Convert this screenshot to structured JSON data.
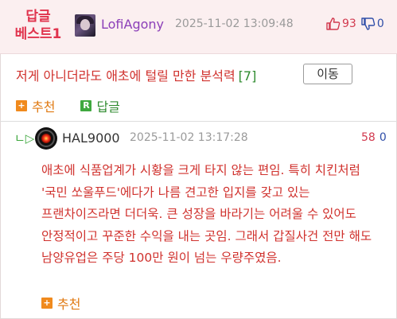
{
  "best_reply": {
    "badge_line1": "답글",
    "badge_line2": "베스트1",
    "nickname": "LofiAgony",
    "datetime": "2025-11-02 13:09:48",
    "upvotes": "93",
    "downvotes": "0"
  },
  "parent_quote": {
    "text": "저게 아니더라도 애초에 털릴 만한 분석력",
    "reply_count": "[7]",
    "move_button": "이동"
  },
  "actions": {
    "recommend_label": "추천",
    "reply_label": "답글"
  },
  "reply_comment": {
    "arrow": "ㄴ▷",
    "nickname": "HAL9000",
    "datetime": "2025-11-02 13:17:28",
    "upvotes": "58",
    "downvotes": "0",
    "body": "애초에 식품업계가 시황을 크게 타지 않는 편임. 특히 치킨처럼 '국민 쏘울푸드'에다가 나름 견고한 입지를 갖고 있는 프랜차이즈라면 더더욱. 큰 성장을 바라기는 어려울 수 있어도 안정적이고 꾸준한 수익을 내는 곳임. 그래서 갑질사건 전만 해도 남양유업은 주당 100만 원이 넘는 우량주였음.",
    "recommend_label": "추천"
  },
  "colors": {
    "best_badge": "#e0334d",
    "nickname_purple": "#8b3fb8",
    "body_red": "#d0312d",
    "recommend_orange": "#f08a1d",
    "reply_green": "#3fa83f"
  }
}
